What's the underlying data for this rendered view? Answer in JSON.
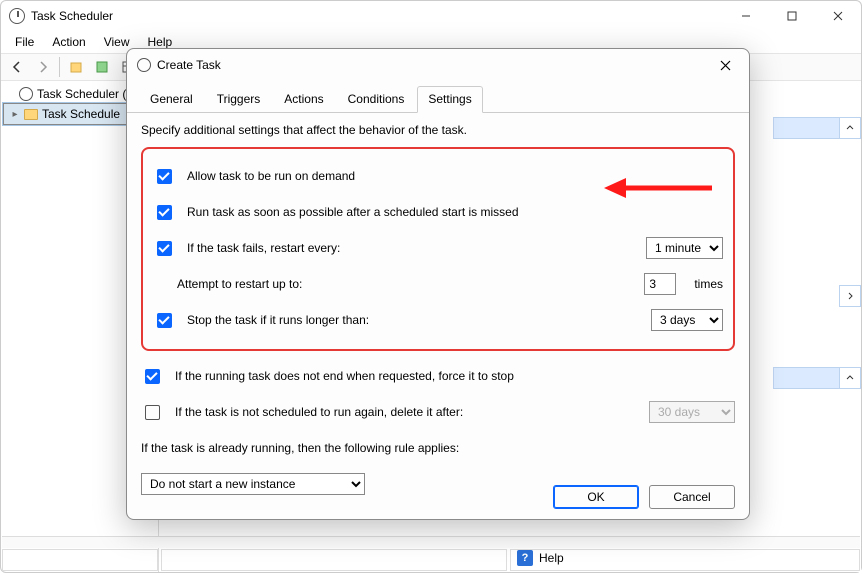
{
  "window": {
    "title": "Task Scheduler",
    "menus": [
      "File",
      "Action",
      "View",
      "Help"
    ]
  },
  "tree": {
    "root": "Task Scheduler (L",
    "child": "Task Schedule"
  },
  "help": {
    "label": "Help"
  },
  "dialog": {
    "title": "Create Task",
    "tabs": [
      "General",
      "Triggers",
      "Actions",
      "Conditions",
      "Settings"
    ],
    "active_tab": 4,
    "description": "Specify additional settings that affect the behavior of the task.",
    "options": {
      "allow_on_demand": {
        "label": "Allow task to be run on demand",
        "checked": true
      },
      "run_asap": {
        "label": "Run task as soon as possible after a scheduled start is missed",
        "checked": true
      },
      "restart_if_fail": {
        "label": "If the task fails, restart every:",
        "checked": true,
        "value": "1 minute"
      },
      "attempt_up_to": {
        "label": "Attempt to restart up to:",
        "value": "3",
        "unit": "times"
      },
      "stop_if_longer": {
        "label": "Stop the task if it runs longer than:",
        "checked": true,
        "value": "3 days"
      },
      "force_stop": {
        "label": "If the running task does not end when requested, force it to stop",
        "checked": true
      },
      "delete_after": {
        "label": "If the task is not scheduled to run again, delete it after:",
        "checked": false,
        "value": "30 days"
      },
      "already_running": {
        "label": "If the task is already running, then the following rule applies:"
      },
      "rule": {
        "value": "Do not start a new instance"
      }
    },
    "buttons": {
      "ok": "OK",
      "cancel": "Cancel"
    }
  }
}
